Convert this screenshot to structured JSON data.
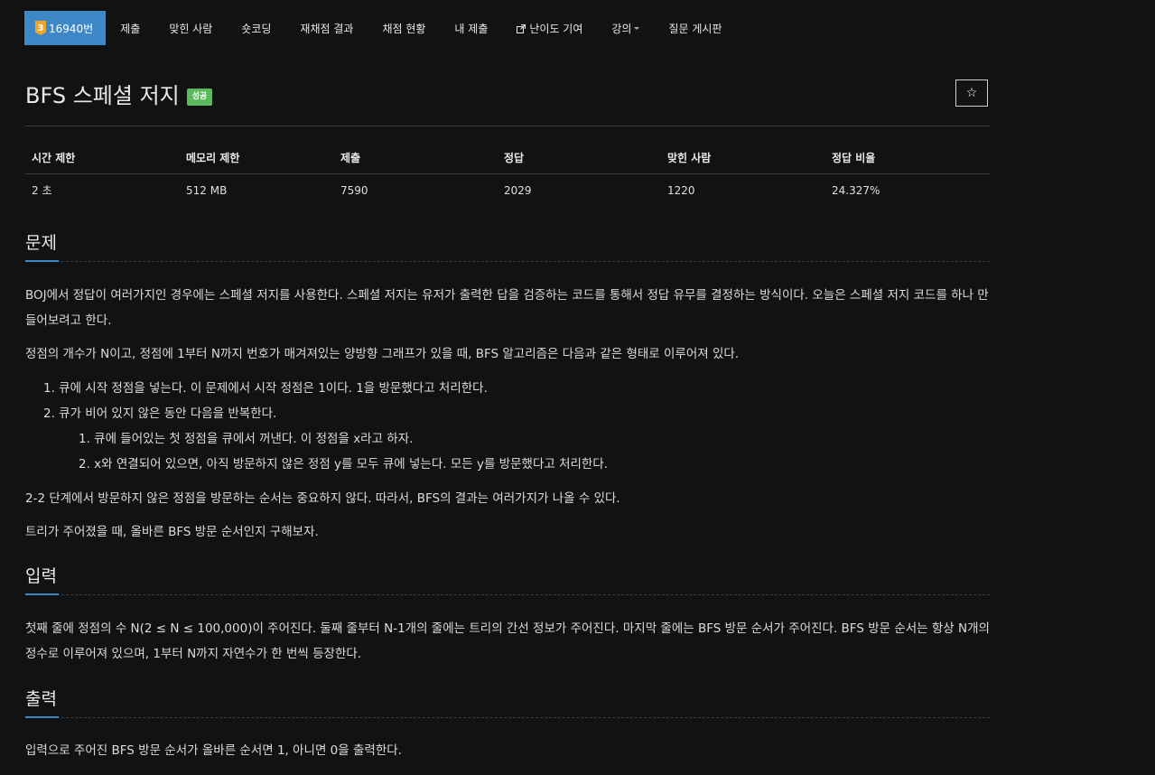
{
  "nav": {
    "problem_tier": "3",
    "problem_number": "16940번",
    "items": [
      "제출",
      "맞힌 사람",
      "숏코딩",
      "재채점 결과",
      "채점 현황",
      "내 제출",
      "난이도 기여",
      "강의",
      "질문 게시판"
    ]
  },
  "title": {
    "text": "BFS 스페셜 저지",
    "status": "성공",
    "star": "☆"
  },
  "info": {
    "headers": [
      "시간 제한",
      "메모리 제한",
      "제출",
      "정답",
      "맞힌 사람",
      "정답 비율"
    ],
    "values": [
      "2 초",
      "512 MB",
      "7590",
      "2029",
      "1220",
      "24.327%"
    ]
  },
  "problem": {
    "heading": "문제",
    "p1": "BOJ에서 정답이 여러가지인 경우에는 스페셜 저지를 사용한다. 스페셜 저지는 유저가 출력한 답을 검증하는 코드를 통해서 정답 유무를 결정하는 방식이다. 오늘은 스페셜 저지 코드를 하나 만들어보려고 한다.",
    "p2": "정점의 개수가 N이고, 정점에 1부터 N까지 번호가 매겨져있는 양방향 그래프가 있을 때, BFS 알고리즘은 다음과 같은 형태로 이루어져 있다.",
    "steps": [
      "1. 큐에 시작 정점을 넣는다. 이 문제에서 시작 정점은 1이다. 1을 방문했다고 처리한다.",
      "2. 큐가 비어 있지 않은 동안 다음을 반복한다."
    ],
    "substeps": [
      "1. 큐에 들어있는 첫 정점을 큐에서 꺼낸다. 이 정점을 x라고 하자.",
      "2. x와 연결되어 있으면, 아직 방문하지 않은 정점 y를 모두 큐에 넣는다. 모든 y를 방문했다고 처리한다."
    ],
    "p3": "2-2 단계에서 방문하지 않은 정점을 방문하는 순서는 중요하지 않다. 따라서, BFS의 결과는 여러가지가 나올 수 있다.",
    "p4": "트리가 주어졌을 때, 올바른 BFS 방문 순서인지 구해보자."
  },
  "input": {
    "heading": "입력",
    "p1": "첫째 줄에 정점의 수 N(2 ≤ N ≤ 100,000)이 주어진다. 둘째 줄부터 N-1개의 줄에는 트리의 간선 정보가 주어진다. 마지막 줄에는 BFS 방문 순서가 주어진다. BFS 방문 순서는 항상 N개의 정수로 이루어져 있으며, 1부터 N까지 자연수가 한 번씩 등장한다."
  },
  "output": {
    "heading": "출력",
    "p1": "입력으로 주어진 BFS 방문 순서가 올바른 순서면 1, 아니면 0을 출력한다."
  }
}
